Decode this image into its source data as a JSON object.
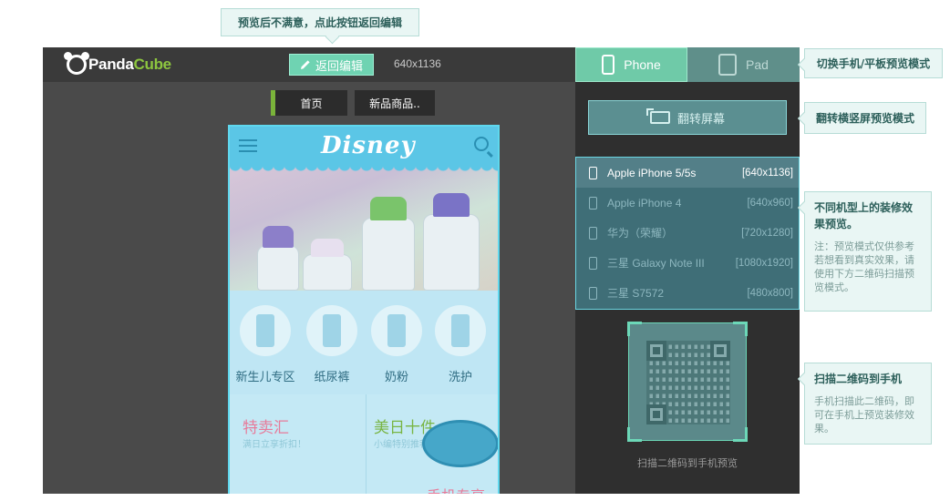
{
  "header": {
    "logo_part1": "Panda",
    "logo_part2": "Cube",
    "back_button_label": "返回编辑",
    "resolution": "640x1136"
  },
  "nav_tabs": [
    {
      "label": "首页"
    },
    {
      "label": "新品商品.."
    }
  ],
  "phone_preview": {
    "brand": "Disney",
    "categories": [
      {
        "label": "新生儿专区"
      },
      {
        "label": "纸尿裤"
      },
      {
        "label": "奶粉"
      },
      {
        "label": "洗护"
      }
    ],
    "promos": {
      "left_title": "特卖汇",
      "left_sub": "满日立享折扣！",
      "right_title": "美日十件",
      "right_sub": "小编特别推荐",
      "bottom_text": "手机专享"
    }
  },
  "mode_tabs": [
    {
      "label": "Phone",
      "active": true
    },
    {
      "label": "Pad",
      "active": false
    }
  ],
  "rotate_button_label": "翻转屏幕",
  "devices": [
    {
      "name": "Apple iPhone 5/5s",
      "resolution": "[640x1136]",
      "active": true
    },
    {
      "name": "Apple iPhone 4",
      "resolution": "[640x960]",
      "active": false
    },
    {
      "name": "华为（荣耀）",
      "resolution": "[720x1280]",
      "active": false
    },
    {
      "name": "三星 Galaxy Note III",
      "resolution": "[1080x1920]",
      "active": false
    },
    {
      "name": "三星 S7572",
      "resolution": "[480x800]",
      "active": false
    }
  ],
  "qr_caption": "扫描二维码到手机预览",
  "callouts": {
    "top": "预览后不满意，点此按钮返回编辑",
    "mode": "切换手机/平板预览模式",
    "rotate": "翻转横竖屏预览模式",
    "devices_head": "不同机型上的装修效果预览。",
    "devices_body": "注：预览模式仅供参考若想看到真实效果，请使用下方二维码扫描预览模式。",
    "qr_head": "扫描二维码到手机",
    "qr_body": "手机扫描此二维码，即可在手机上预览装修效果。"
  },
  "colors": {
    "accent_green": "#6fcaa8",
    "highlight_cyan": "#5fd8ee",
    "dark_bg": "#2f2f2f",
    "logo_green": "#8dc63f"
  }
}
